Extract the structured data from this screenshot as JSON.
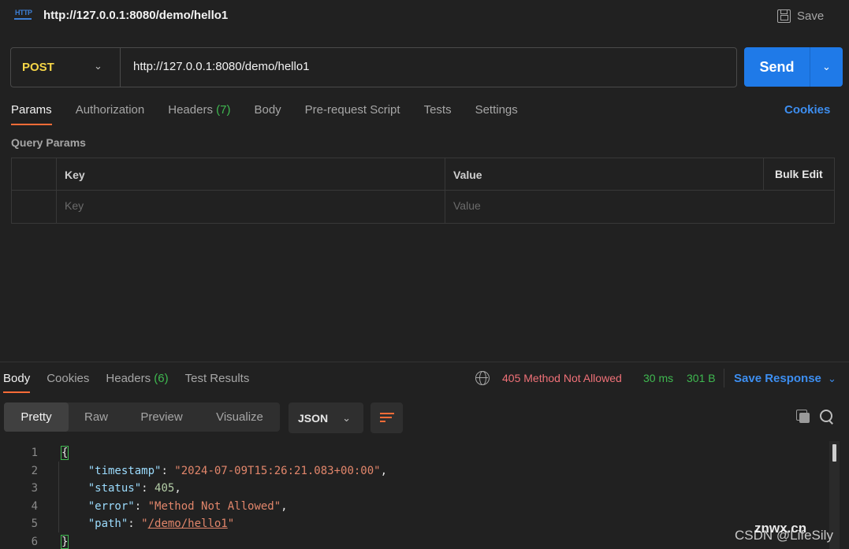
{
  "header": {
    "icon": "http-icon",
    "icon_text": "HTTP",
    "title": "http://127.0.0.1:8080/demo/hello1",
    "save_label": "Save"
  },
  "request": {
    "method": "POST",
    "url": "http://127.0.0.1:8080/demo/hello1",
    "send_label": "Send"
  },
  "request_tabs": {
    "params": "Params",
    "authorization": "Authorization",
    "headers": "Headers",
    "headers_count": "(7)",
    "body": "Body",
    "pre_request": "Pre-request Script",
    "tests": "Tests",
    "settings": "Settings",
    "active": "Params"
  },
  "cookies_label": "Cookies",
  "query_params": {
    "title": "Query Params",
    "columns": {
      "key": "Key",
      "value": "Value"
    },
    "bulk_edit": "Bulk Edit",
    "key_placeholder": "Key",
    "value_placeholder": "Value"
  },
  "response_tabs": {
    "body": "Body",
    "cookies": "Cookies",
    "headers": "Headers",
    "headers_count": "(6)",
    "test_results": "Test Results",
    "active": "Body"
  },
  "response_meta": {
    "status": "405 Method Not Allowed",
    "time": "30 ms",
    "size": "301 B",
    "save_response": "Save Response"
  },
  "view_tabs": {
    "pretty": "Pretty",
    "raw": "Raw",
    "preview": "Preview",
    "visualize": "Visualize",
    "active": "Pretty"
  },
  "format": "JSON",
  "code": {
    "line_numbers": [
      "1",
      "2",
      "3",
      "4",
      "5",
      "6"
    ],
    "open_brace": "{",
    "close_brace": "}",
    "timestamp_key": "\"timestamp\"",
    "timestamp_val": "\"2024-07-09T15:26:21.083+00:00\"",
    "status_key": "\"status\"",
    "status_val": "405",
    "error_key": "\"error\"",
    "error_val": "\"Method Not Allowed\"",
    "path_key": "\"path\"",
    "path_quote_open": "\"",
    "path_val": "/demo/hello1",
    "path_quote_close": "\""
  },
  "watermark": {
    "site": "znwx.cn",
    "author": "CSDN @LifeSily"
  },
  "colors": {
    "accent": "#ff6c37",
    "send": "#1f7ae8",
    "method": "#f5d547",
    "status_error": "#f07178",
    "success": "#3fb950",
    "link": "#3d8ef0"
  }
}
